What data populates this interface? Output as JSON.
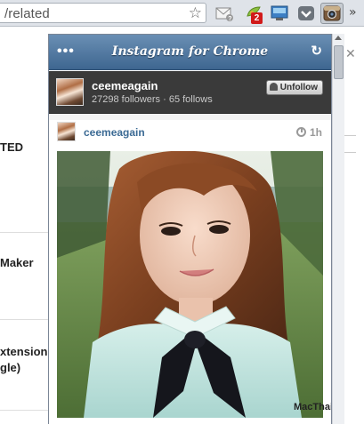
{
  "browser": {
    "url_text": "/related",
    "extension_badge": "2",
    "overflow_label": "»"
  },
  "background_page": {
    "items": [
      "TED",
      "Maker",
      "xtension",
      "gle)"
    ]
  },
  "popup": {
    "title": "Instagram for Chrome",
    "menu_label": "•••",
    "profile": {
      "username": "ceemeagain",
      "stats": "27298 followers · 65 follows",
      "unfollow_label": "Unfollow"
    },
    "post": {
      "username": "ceemeagain",
      "time": "1h",
      "watermark": "MacThai.Net"
    }
  },
  "colors": {
    "header_blue": "#4f7aa3",
    "profile_bar": "#3a3a3a",
    "username_link": "#3b6a94",
    "badge_red": "#d11a1a"
  },
  "icons": [
    "star-icon",
    "mail-icon",
    "extension-icon",
    "screen-capture-icon",
    "shield-icon",
    "camera-icon",
    "menu-dots-icon",
    "refresh-icon",
    "user-icon",
    "clock-icon"
  ]
}
